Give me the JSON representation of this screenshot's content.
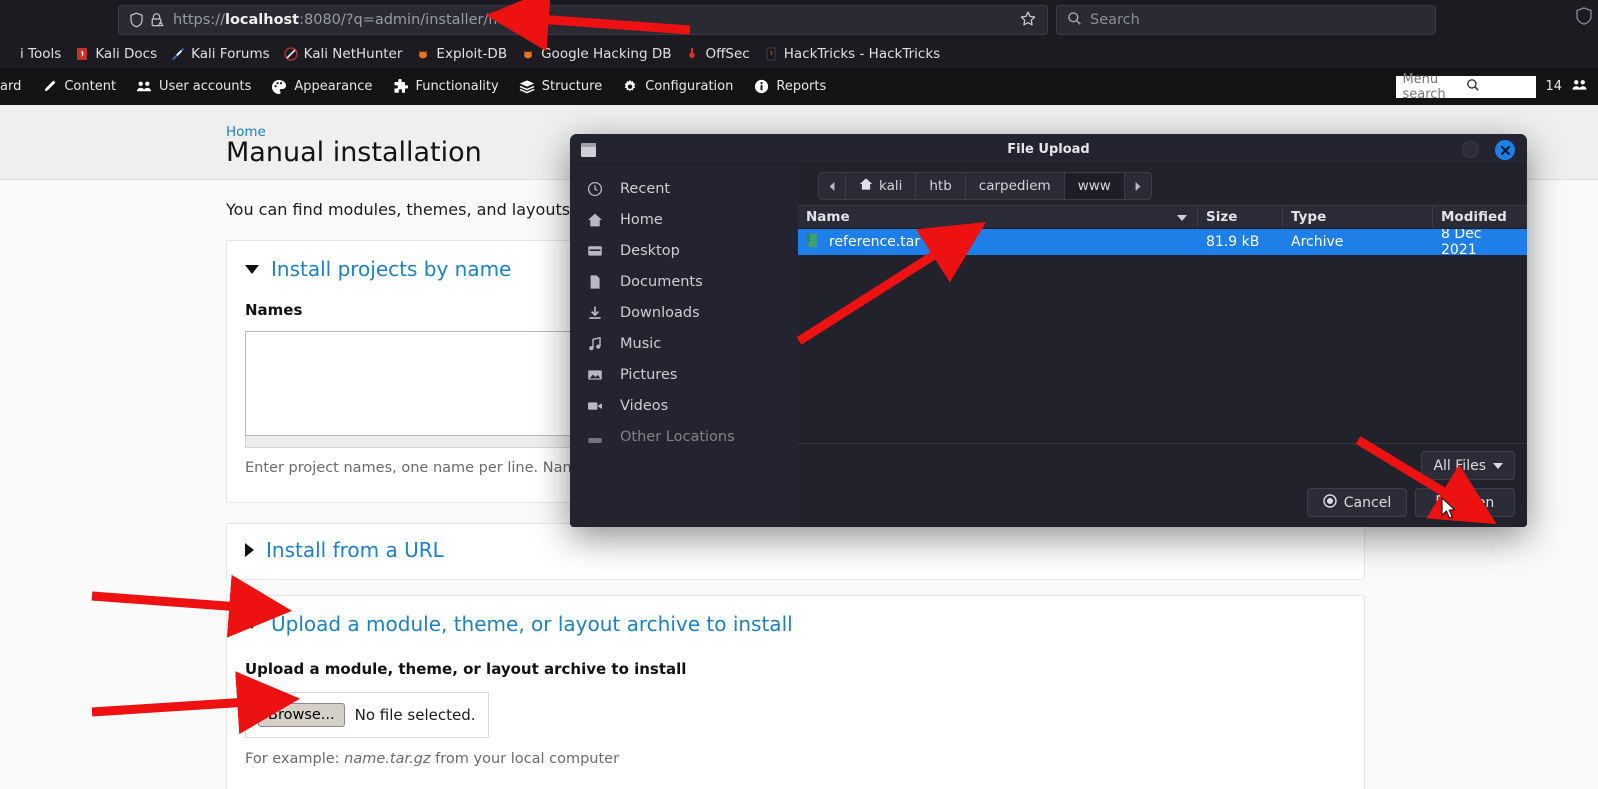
{
  "browser": {
    "url_protocol": "https://",
    "url_host": "localhost",
    "url_rest": ":8080/?q=admin/installer/manual",
    "url_full": "https://localhost:8080/?q=admin/installer/manual",
    "search_placeholder": "Search",
    "shield_icon": "shield-icon",
    "lock_warning_icon": "lock-warning-icon",
    "bookmark_star_icon": "star-icon",
    "search_icon": "search-icon",
    "bookmarks": [
      {
        "label": "i Tools",
        "icon": "kali-tools-icon"
      },
      {
        "label": "Kali Docs",
        "icon": "kali-docs-icon"
      },
      {
        "label": "Kali Forums",
        "icon": "kali-forums-icon"
      },
      {
        "label": "Kali NetHunter",
        "icon": "kali-nethunter-icon"
      },
      {
        "label": "Exploit-DB",
        "icon": "exploit-db-icon"
      },
      {
        "label": "Google Hacking DB",
        "icon": "google-hacking-db-icon"
      },
      {
        "label": "OffSec",
        "icon": "offsec-icon"
      },
      {
        "label": "HackTricks - HackTricks",
        "icon": "hacktricks-icon"
      }
    ]
  },
  "admin_toolbar": {
    "items": [
      {
        "label": "ard",
        "icon": "dashboard-icon"
      },
      {
        "label": "Content",
        "icon": "pencil-icon"
      },
      {
        "label": "User accounts",
        "icon": "users-icon"
      },
      {
        "label": "Appearance",
        "icon": "palette-icon"
      },
      {
        "label": "Functionality",
        "icon": "puzzle-icon"
      },
      {
        "label": "Structure",
        "icon": "layers-icon"
      },
      {
        "label": "Configuration",
        "icon": "gear-icon"
      },
      {
        "label": "Reports",
        "icon": "info-icon"
      }
    ],
    "menu_search_placeholder": "Menu search",
    "menu_search_icon": "search-icon",
    "online_users_count": "14",
    "online_users_icon": "users-icon"
  },
  "page": {
    "breadcrumb": "Home",
    "title": "Manual installation",
    "intro": "You can find modules, themes, and layouts on",
    "sections": [
      {
        "title": "Install projects by name",
        "state": "expanded",
        "field_label": "Names",
        "textarea_value": "",
        "help": "Enter project names, one name per line. Names"
      },
      {
        "title": "Install from a URL",
        "state": "collapsed"
      },
      {
        "title": "Upload a module, theme, or layout archive to install",
        "state": "expanded",
        "field_label": "Upload a module, theme, or layout archive to install",
        "browse_label": "Browse...",
        "file_status": "No file selected.",
        "help_prefix": "For example: ",
        "help_em": "name.tar.gz",
        "help_suffix": " from your local computer"
      }
    ]
  },
  "dialog": {
    "title": "File Upload",
    "window_icon": "window-icon",
    "minimize_icon": "circle-icon",
    "close_icon": "close-icon",
    "sidebar": [
      {
        "label": "Recent",
        "icon": "clock-icon"
      },
      {
        "label": "Home",
        "icon": "home-icon"
      },
      {
        "label": "Desktop",
        "icon": "desktop-icon"
      },
      {
        "label": "Documents",
        "icon": "document-icon"
      },
      {
        "label": "Downloads",
        "icon": "download-icon"
      },
      {
        "label": "Music",
        "icon": "music-note-icon"
      },
      {
        "label": "Pictures",
        "icon": "image-icon"
      },
      {
        "label": "Videos",
        "icon": "video-camera-icon"
      },
      {
        "label": "Other Locations",
        "icon": "other-locations-icon"
      }
    ],
    "path": {
      "back_icon": "chevron-left-icon",
      "forward_icon": "chevron-right-icon",
      "home_icon": "home-icon",
      "segments": [
        {
          "label": "kali",
          "active": false,
          "icon": "home-icon"
        },
        {
          "label": "htb",
          "active": false
        },
        {
          "label": "carpediem",
          "active": false
        },
        {
          "label": "www",
          "active": true
        }
      ]
    },
    "columns": [
      "Name",
      "Size",
      "Type",
      "Modified"
    ],
    "sort_icon": "sort-descending-icon",
    "files": [
      {
        "name": "reference.tar",
        "size": "81.9 kB",
        "type": "Archive",
        "modified": "8 Dec 2021",
        "icon": "archive-file-icon",
        "selected": true
      }
    ],
    "filter_label": "All Files",
    "filter_caret_icon": "chevron-down-icon",
    "cancel_label": "Cancel",
    "cancel_icon": "cancel-icon",
    "open_label": "Open",
    "open_icon": "open-icon"
  },
  "annotations": {
    "arrow_color": "#ee1111",
    "cursor_icon": "mouse-cursor",
    "arrows": [
      {
        "name": "arrow-to-urlbar"
      },
      {
        "name": "arrow-to-selected-file"
      },
      {
        "name": "arrow-to-open-button"
      },
      {
        "name": "arrow-to-upload-section"
      },
      {
        "name": "arrow-to-browse-button"
      }
    ]
  },
  "colors": {
    "accent_blue": "#1e81c4",
    "selection_blue": "#1f7fe8",
    "browser_chrome": "#1c1b22",
    "admin_bar": "#141414",
    "dialog_bg": "#21222c"
  }
}
